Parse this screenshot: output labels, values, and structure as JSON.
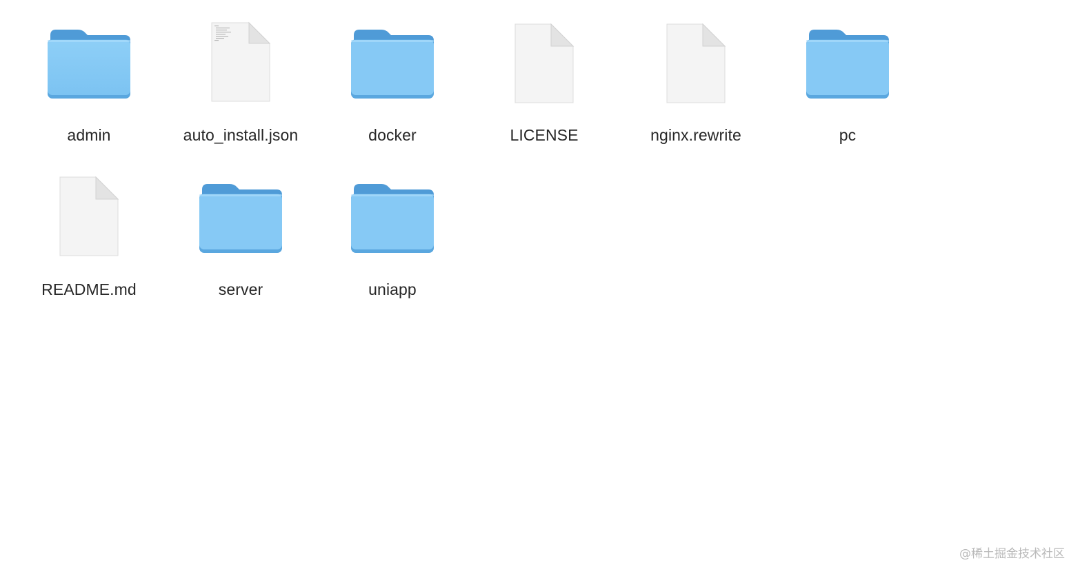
{
  "files": [
    {
      "name": "admin",
      "kind": "folder",
      "icon": "folder-icon"
    },
    {
      "name": "auto_install.json",
      "kind": "document-with-text",
      "icon": "json-document-icon"
    },
    {
      "name": "docker",
      "kind": "folder",
      "icon": "folder-icon"
    },
    {
      "name": "LICENSE",
      "kind": "document",
      "icon": "document-icon"
    },
    {
      "name": "nginx.rewrite",
      "kind": "document",
      "icon": "document-icon"
    },
    {
      "name": "pc",
      "kind": "folder",
      "icon": "folder-icon"
    },
    {
      "name": "README.md",
      "kind": "document",
      "icon": "document-icon"
    },
    {
      "name": "server",
      "kind": "folder",
      "icon": "folder-icon"
    },
    {
      "name": "uniapp",
      "kind": "folder",
      "icon": "folder-icon"
    }
  ],
  "watermark": "@稀土掘金技术社区",
  "colors": {
    "folder_body": "#85c9f5",
    "folder_back": "#4f9bd7",
    "label_text": "#262626"
  }
}
